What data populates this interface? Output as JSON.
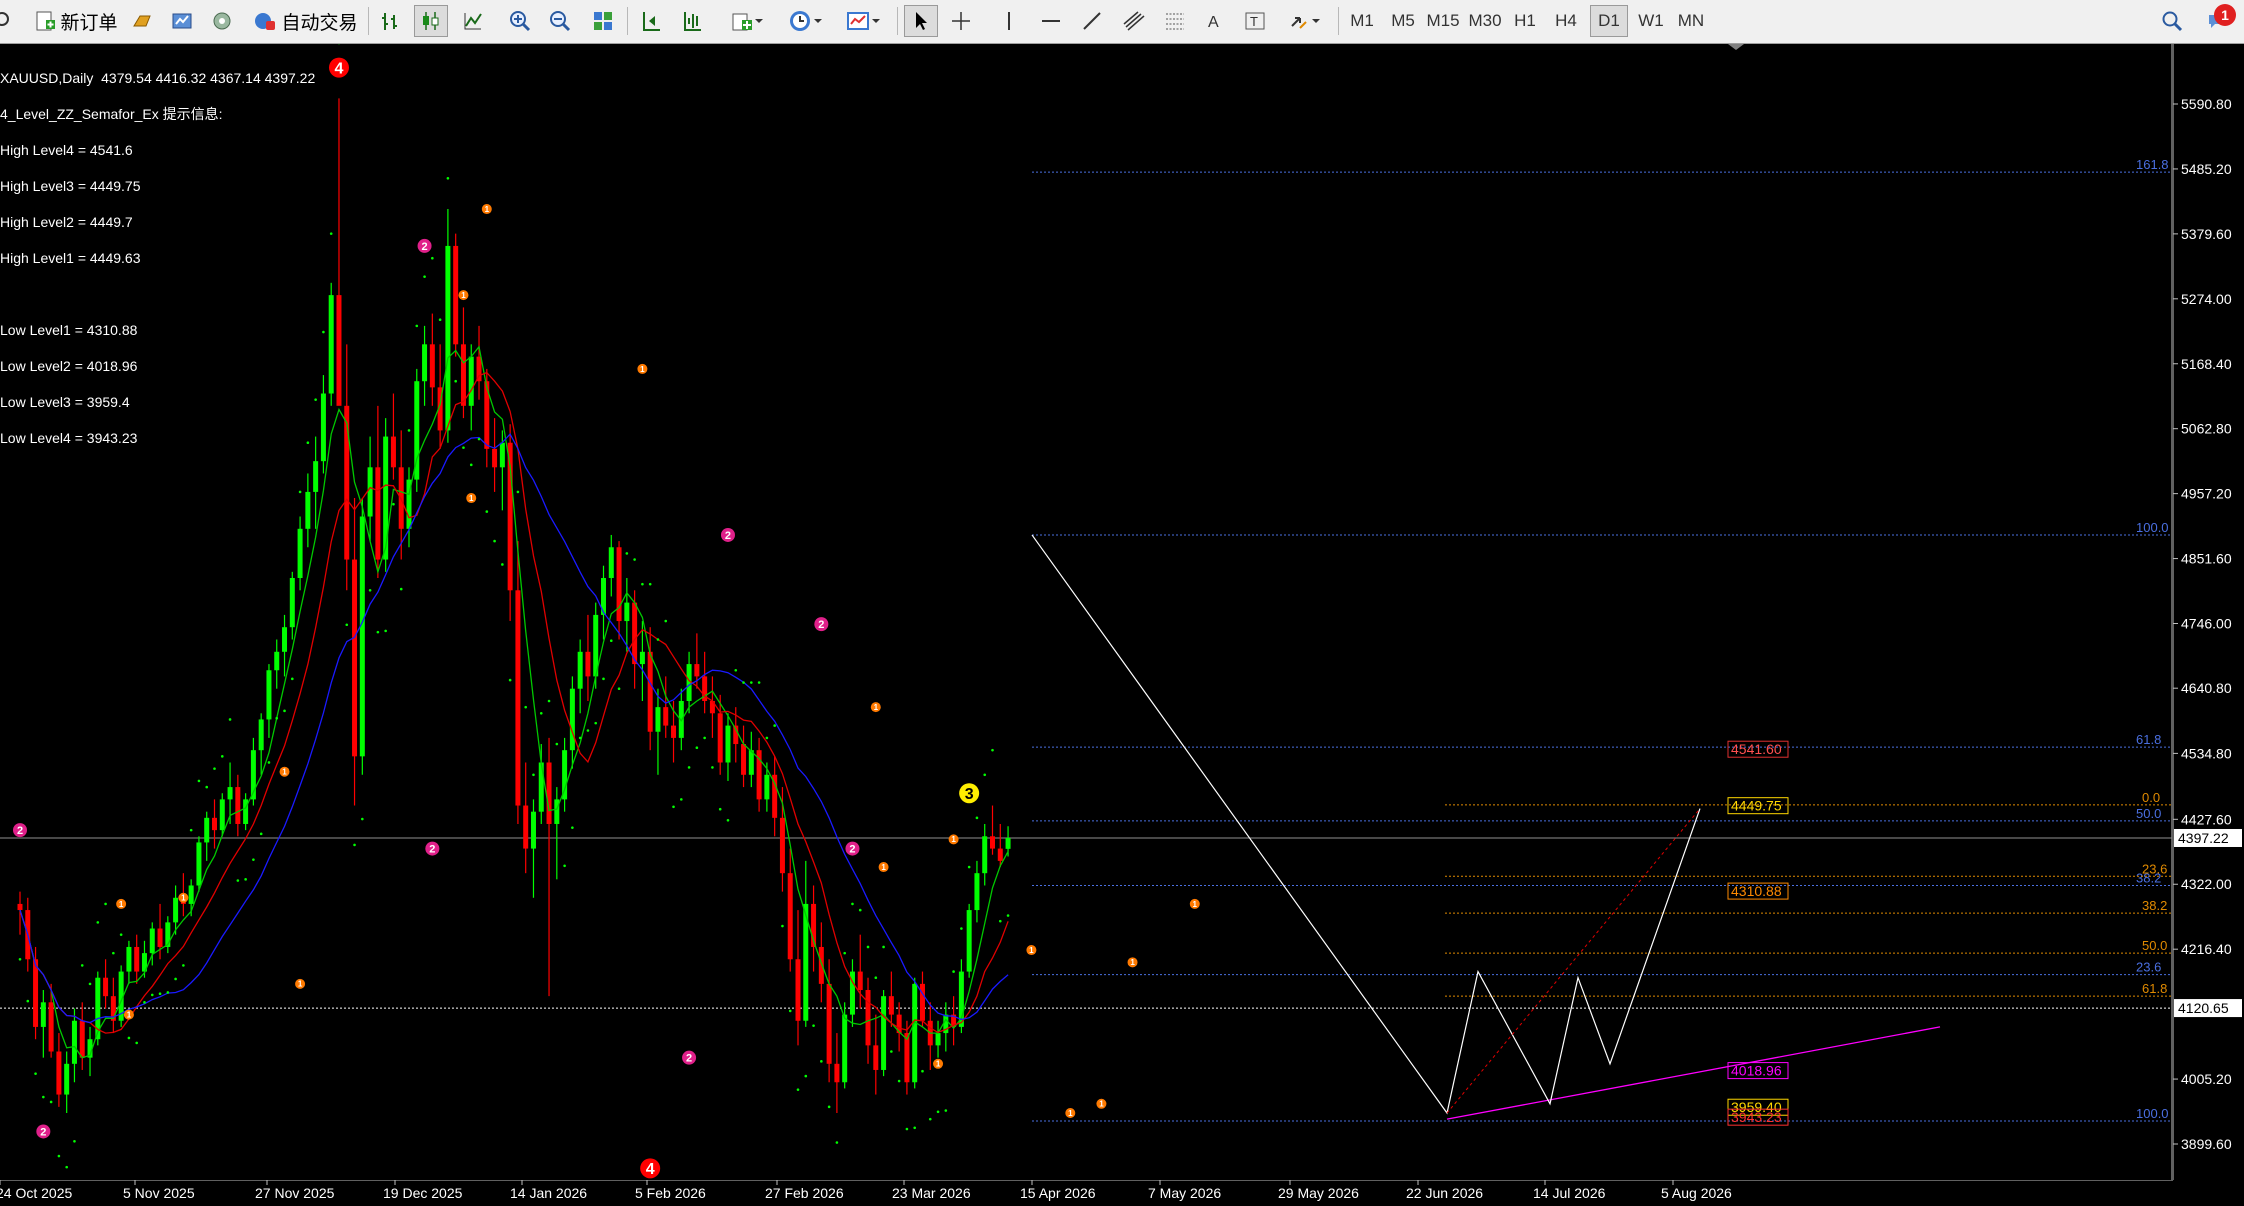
{
  "toolbar": {
    "new_order_label": "新订单",
    "auto_trading_label": "自动交易",
    "timeframes": [
      "M1",
      "M5",
      "M15",
      "M30",
      "H1",
      "H4",
      "D1",
      "W1",
      "MN"
    ],
    "active_timeframe": "D1",
    "notification_count": "1"
  },
  "chart": {
    "header": "XAUUSD,Daily  4379.54 4416.32 4367.14 4397.22",
    "indicator_name": "4_Level_ZZ_Semafor_Ex 提示信息:",
    "high_levels": [
      "High Level4 = 4541.6",
      "High Level3 = 4449.75",
      "High Level2 = 4449.7",
      "High Level1 = 4449.63"
    ],
    "low_levels": [
      "Low Level1 = 4310.88",
      "Low Level2 = 4018.96",
      "Low Level3 = 3959.4",
      "Low Level4 = 3943.23"
    ],
    "current_price": "4397.22",
    "marked_price": "4120.65",
    "price_ticks": [
      "5590.80",
      "5485.20",
      "5379.60",
      "5274.00",
      "5168.40",
      "5062.80",
      "4957.20",
      "4851.60",
      "4746.00",
      "4640.80",
      "4534.80",
      "4427.60",
      "4322.00",
      "4216.40",
      "4005.20",
      "3899.60"
    ],
    "date_ticks": [
      "24 Oct 2025",
      "5 Nov 2025",
      "27 Nov 2025",
      "19 Dec 2025",
      "14 Jan 2026",
      "5 Feb 2026",
      "27 Feb 2026",
      "23 Mar 2026",
      "15 Apr 2026",
      "7 May 2026",
      "29 May 2026",
      "22 Jun 2026",
      "14 Jul 2026",
      "5 Aug 2026"
    ],
    "fib_big": [
      "161.8",
      "100.0",
      "61.8",
      "50.0",
      "38.2",
      "23.6",
      "100.0"
    ],
    "fib_small": [
      "0.0",
      "23.6",
      "38.2",
      "50.0",
      "61.8"
    ],
    "level_boxes": [
      "4541.60",
      "4449.75",
      "4310.88",
      "4018.96",
      "3959.40",
      "3943.23"
    ],
    "semafor_big": [
      "4",
      "4",
      "3"
    ]
  },
  "chart_data": {
    "type": "candlestick",
    "symbol": "XAUUSD",
    "timeframe": "Daily",
    "last_bar": {
      "open": 4379.54,
      "high": 4416.32,
      "low": 4367.14,
      "close": 4397.22
    },
    "ylim": [
      3860,
      5650
    ],
    "y_ticks": [
      5590.8,
      5485.2,
      5379.6,
      5274.0,
      5168.4,
      5062.8,
      4957.2,
      4851.6,
      4746.0,
      4640.8,
      4534.8,
      4427.6,
      4322.0,
      4216.4,
      4005.2,
      3899.6
    ],
    "x_ticks": [
      "24 Oct 2025",
      "5 Nov 2025",
      "27 Nov 2025",
      "19 Dec 2025",
      "14 Jan 2026",
      "5 Feb 2026",
      "27 Feb 2026",
      "23 Mar 2026",
      "15 Apr 2026",
      "7 May 2026",
      "29 May 2026",
      "22 Jun 2026",
      "14 Jul 2026",
      "5 Aug 2026"
    ],
    "levels": {
      "high4": 4541.6,
      "high3": 4449.75,
      "high2": 4449.7,
      "high1": 4449.63,
      "low1": 4310.88,
      "low2": 4018.96,
      "low3": 3959.4,
      "low4": 3943.23
    },
    "horizontal_lines": [
      4397.22,
      4120.65
    ],
    "colors": {
      "bull": "#00ff00",
      "bear": "#ff0000",
      "ma_fast": "#00c800",
      "ma_mid": "#e00000",
      "ma_slow": "#1a1aff",
      "sar": "#00ff00",
      "fib_big": "#4a6fe0",
      "fib_small": "#e08a00",
      "trendline": "#ff00ff",
      "zigzag": "#ffffff"
    }
  }
}
